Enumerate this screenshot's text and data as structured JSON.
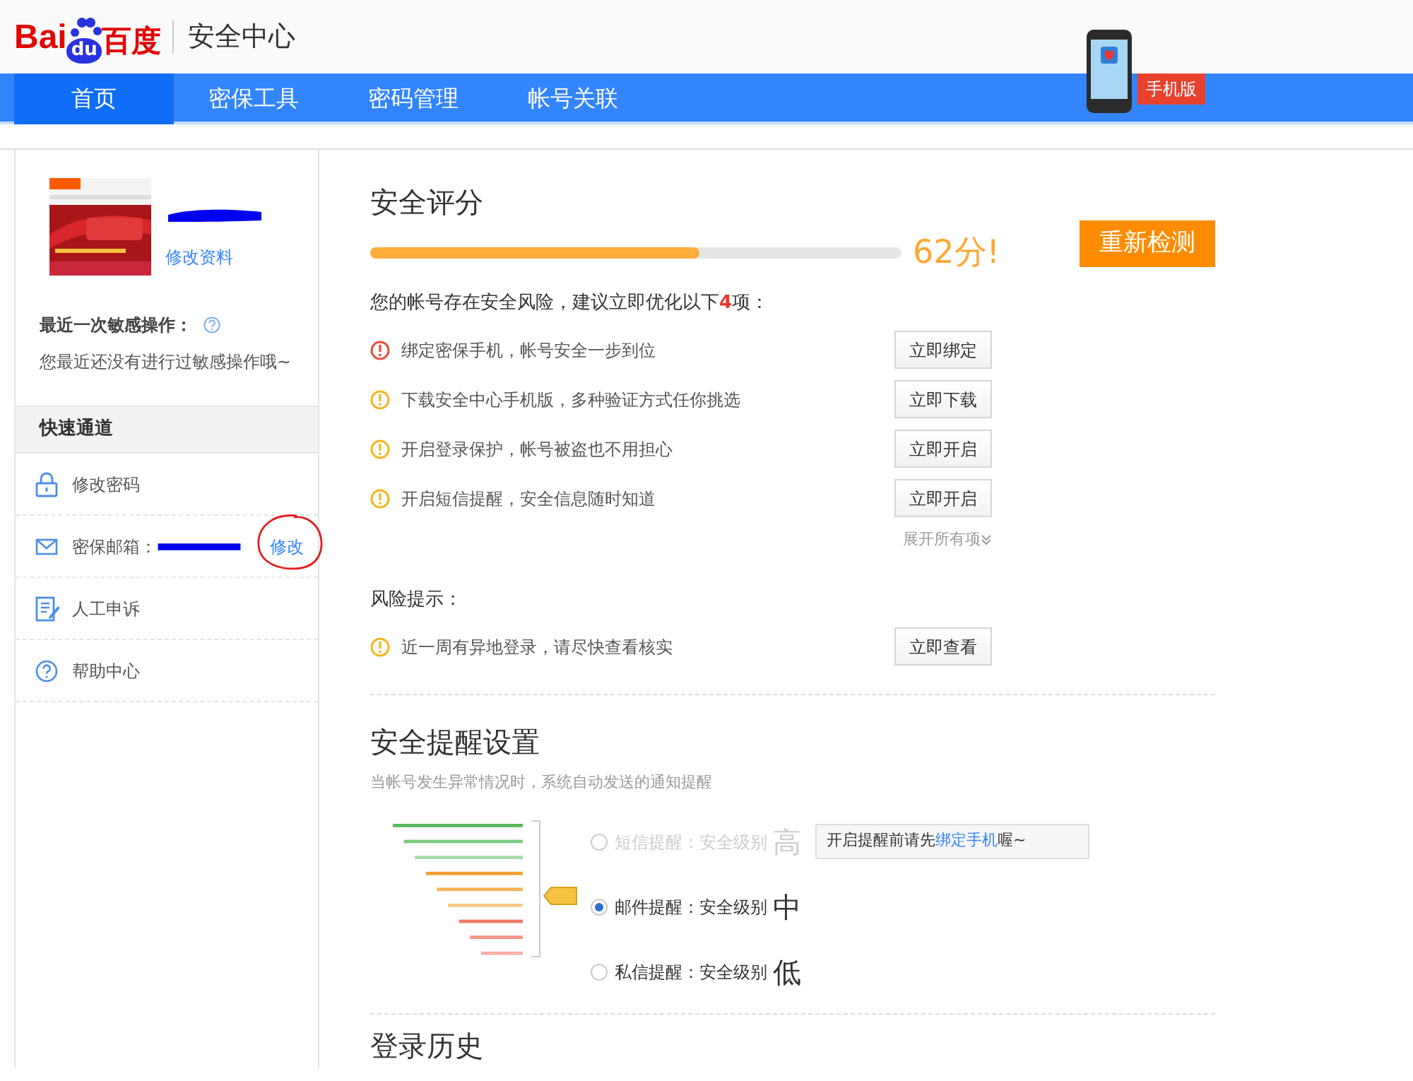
{
  "header": {
    "logo_latin": "Bai",
    "logo_du": "du",
    "logo_cn": "百度",
    "title": "安全中心",
    "mobile_banner": "手机版"
  },
  "nav": [
    {
      "label": "首页",
      "selected": true
    },
    {
      "label": "密保工具",
      "selected": false
    },
    {
      "label": "密码管理",
      "selected": false
    },
    {
      "label": "帐号关联",
      "selected": false
    }
  ],
  "profile": {
    "edit_link": "修改资料"
  },
  "recent": {
    "title": "最近一次敏感操作：",
    "text": "您最近还没有进行过敏感操作哦~"
  },
  "quick": {
    "title": "快速通道",
    "items": [
      {
        "kind": "lock",
        "label": "修改密码"
      },
      {
        "kind": "mail",
        "label": "密保邮箱：",
        "action": "修改"
      },
      {
        "kind": "edit",
        "label": "人工申诉"
      },
      {
        "kind": "help",
        "label": "帮助中心"
      }
    ]
  },
  "score": {
    "title": "安全评分",
    "level": 0.62,
    "reading": "62分!",
    "recheck": "重新检测",
    "summary": "您的帐号存在安全风险，建议立即优化以下**4**项：",
    "items": [
      {
        "color": "#e84c3d",
        "text": "绑定密保手机，帐号安全一步到位",
        "action": "立即绑定"
      },
      {
        "color": "#f6b51e",
        "text": "下载安全中心手机版，多种验证方式任你挑选",
        "action": "立即下载"
      },
      {
        "color": "#f6b51e",
        "text": "开启登录保护，帐号被盗也不用担心",
        "action": "立即开启"
      },
      {
        "color": "#f6b51e",
        "text": "开启短信提醒，安全信息随时知道",
        "action": "立即开启"
      }
    ],
    "expand": "展开所有项"
  },
  "risk": {
    "title": "风险提示：",
    "items": [
      {
        "color": "#f6b51e",
        "text": "近一周有异地登录，请尽快查看核实",
        "action": "立即查看"
      }
    ]
  },
  "alerts": {
    "title": "安全提醒设置",
    "subtitle": "当帐号发生异常情况时，系统自动发送的通知提醒",
    "options": [
      {
        "label": "短信提醒：安全级别",
        "grade": "高",
        "selected": false,
        "disabled": true
      },
      {
        "label": "邮件提醒：安全级别",
        "grade": "中",
        "selected": true,
        "disabled": false
      },
      {
        "label": "私信提醒：安全级别",
        "grade": "低",
        "selected": false,
        "disabled": false
      }
    ],
    "tip": {
      "before": "开启提醒前请先",
      "link": "绑定手机",
      "after": "喔~"
    }
  },
  "history": {
    "title": "登录历史"
  }
}
